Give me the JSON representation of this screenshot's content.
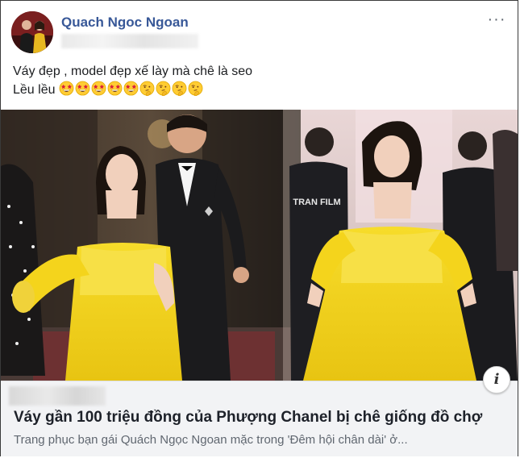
{
  "post": {
    "author": "Quach Ngoc Ngoan",
    "more_label": "···",
    "text_line1": "Váy đẹp , model đẹp xế lày mà chê là seo",
    "text_line2": "Lều lều",
    "emojis": [
      "star-struck-emoji",
      "star-struck-emoji",
      "star-struck-emoji",
      "star-struck-emoji",
      "star-struck-emoji",
      "thinking-emoji",
      "thinking-emoji",
      "thinking-emoji",
      "thinking-emoji"
    ]
  },
  "link": {
    "info_label": "i",
    "title": "Váy gần 100 triệu đồng của Phượng Chanel bị chê giống đồ chợ",
    "description": "Trang phục bạn gái Quách Ngọc Ngoan mặc trong 'Đêm hội chân dài' ở..."
  },
  "photo": {
    "sign_text": "TRAN FILM"
  },
  "colors": {
    "author_link": "#385898",
    "dress_yellow": "#f4d41c",
    "card_bg": "#f2f3f5",
    "desc_gray": "#606770"
  }
}
